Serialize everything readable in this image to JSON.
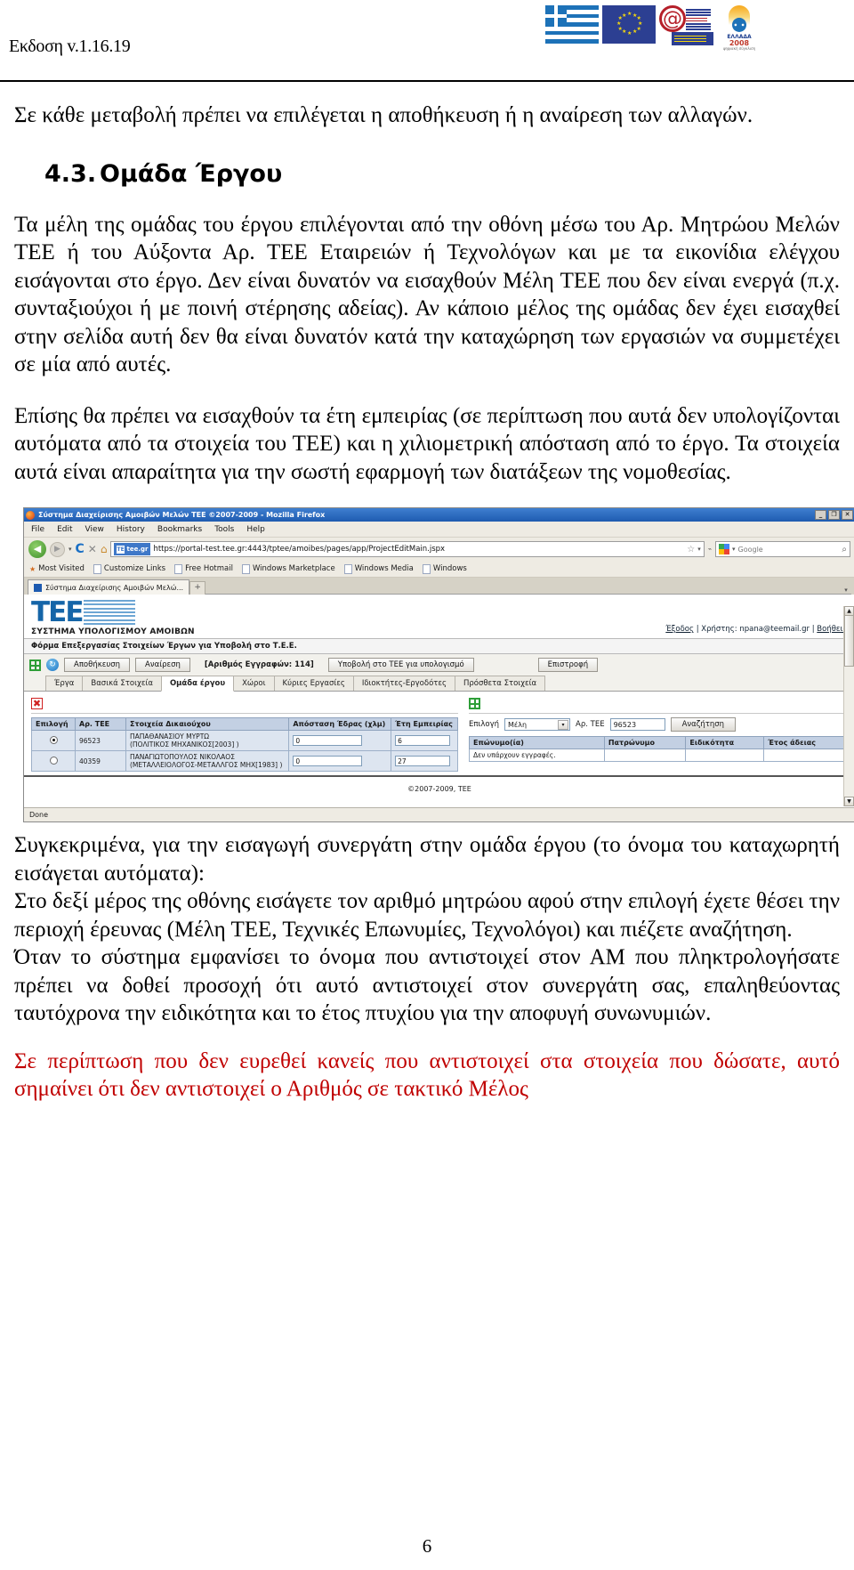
{
  "header": {
    "version_label": "Εκδοση v.1.16.19",
    "logos": [
      {
        "name": "greek-flag-logo",
        "alt": "Ελληνική Σημαία"
      },
      {
        "name": "eu-flag-logo",
        "alt": "Σημαία Ευρωπαϊκής Ένωσης"
      },
      {
        "name": "information-society-logo",
        "alt": "Κοινωνία της Πληροφορίας"
      },
      {
        "name": "greece-2008-logo",
        "alt": "ΕΛΛΑΔΑ 2008"
      }
    ],
    "greece2008": {
      "line1": "ΕΛΛΑΔΑ",
      "line2": "2008",
      "sub": "ψηφιακή σύγκλιση"
    }
  },
  "document": {
    "intro_paragraph": "Σε κάθε μεταβολή πρέπει να επιλέγεται η αποθήκευση ή η αναίρεση των αλλαγών.",
    "section": {
      "number": "4.3.",
      "title": "Ομάδα Έργου"
    },
    "paragraph_1": "Τα μέλη της ομάδας του έργου επιλέγονται από την οθόνη μέσω του Αρ. Μητρώου Μελών ΤΕΕ ή του Αύξοντα Αρ. ΤΕΕ Εταιρειών ή Τεχνολόγων και με τα εικονίδια ελέγχου εισάγονται στο έργο. Δεν είναι δυνατόν να εισαχθούν Μέλη ΤΕΕ που δεν είναι ενεργά (π.χ. συνταξιούχοι ή με ποινή στέρησης αδείας). Αν κάποιο μέλος της ομάδας δεν έχει εισαχθεί στην σελίδα αυτή δεν θα είναι δυνατόν κατά την καταχώρηση των εργασιών να συμμετέχει σε μία από αυτές.",
    "paragraph_2": "Επίσης θα πρέπει να εισαχθούν τα έτη εμπειρίας (σε περίπτωση που αυτά δεν υπολογίζονται αυτόματα από τα στοιχεία του ΤΕΕ) και η χιλιομετρική απόσταση από το έργο. Τα στοιχεία αυτά είναι απαραίτητα για την σωστή εφαρμογή των διατάξεων της νομοθεσίας.",
    "paragraph_3": "Συγκεκριμένα, για την εισαγωγή συνεργάτη στην ομάδα έργου (το όνομα του καταχωρητή εισάγεται αυτόματα):",
    "paragraph_4": "Στο δεξί μέρος της οθόνης εισάγετε τον αριθμό μητρώου αφού στην επιλογή έχετε θέσει την περιοχή έρευνας (Μέλη ΤΕΕ, Τεχνικές Επωνυμίες, Τεχνολόγοι) και πιέζετε αναζήτηση.",
    "paragraph_5": "Όταν το σύστημα εμφανίσει το όνομα που αντιστοιχεί στον ΑΜ που πληκτρολογήσατε  πρέπει να δοθεί προσοχή ότι αυτό αντιστοιχεί στον συνεργάτη σας, επαληθεύοντας ταυτόχρονα την ειδικότητα και το έτος πτυχίου για την αποφυγή συνωνυμιών.",
    "paragraph_red": "Σε περίπτωση που δεν ευρεθεί κανείς που αντιστοιχεί στα στοιχεία που δώσατε, αυτό σημαίνει ότι δεν αντιστοιχεί ο Αριθμός σε τακτικό Μέλος",
    "page_number": "6"
  },
  "screenshot": {
    "window": {
      "title": "Σύστημα Διαχείρισης Αμοιβών Μελών ΤΕΕ ©2007-2009 - Mozilla Firefox",
      "minimize": "_",
      "maximize": "❐",
      "close": "✕"
    },
    "menu": [
      "File",
      "Edit",
      "View",
      "History",
      "Bookmarks",
      "Tools",
      "Help"
    ],
    "nav": {
      "back_icon": "◀",
      "forward_icon": "▶",
      "reload_icon": "C",
      "stop_icon": "✕",
      "home_icon": "⌂",
      "identity_badge": "tee.gr",
      "url": "https://portal-test.tee.gr:4443/tptee/amoibes/pages/app/ProjectEditMain.jspx",
      "bookmark_star": "☆",
      "search_placeholder": "Google"
    },
    "bookmarks": [
      "Most Visited",
      "Customize Links",
      "Free Hotmail",
      "Windows Marketplace",
      "Windows Media",
      "Windows"
    ],
    "tab": {
      "label": "Σύστημα Διαχείρισης Αμοιβών Μελώ...",
      "new_tab": "+"
    },
    "app": {
      "brand": "ΤΕΕ",
      "brand_sub": "ΣΥΣΤΗΜΑ ΥΠΟΛΟΓΙΣΜΟΥ ΑΜΟΙΒΩΝ",
      "logout_link": "Έξοδος",
      "user_label": "Χρήστης:",
      "user_email": "npana@teemail.gr",
      "help_link": "Βοήθεια",
      "separator": "|",
      "form_title": "Φόρμα Επεξεργασίας Στοιχείων Έργων για Υποβολή στο Τ.Ε.Ε.",
      "toolbar": {
        "save": "Αποθήκευση",
        "undo": "Αναίρεση",
        "record_count": "[Αριθμός Εγγραφών: 114]",
        "submit": "Υποβολή στο ΤΕΕ για υπολογισμό",
        "back": "Επιστροφή"
      },
      "tabs": [
        {
          "label": "Έργα",
          "active": false
        },
        {
          "label": "Βασικά Στοιχεία",
          "active": false
        },
        {
          "label": "Ομάδα έργου",
          "active": true
        },
        {
          "label": "Χώροι",
          "active": false
        },
        {
          "label": "Κύριες Εργασίες",
          "active": false
        },
        {
          "label": "Ιδιοκτήτες-Εργοδότες",
          "active": false
        },
        {
          "label": "Πρόσθετα Στοιχεία",
          "active": false
        }
      ],
      "team_grid": {
        "headers": [
          "Επιλογή",
          "Αρ. ΤΕΕ",
          "Στοιχεία Δικαιούχου",
          "Απόσταση Έδρας (χλμ)",
          "Έτη Εμπειρίας"
        ],
        "rows": [
          {
            "selected": true,
            "tee_no": "96523",
            "name": "ΠΑΠΑΘΑΝΑΣΙΟΥ ΜΥΡΤΩ",
            "spec": "(ΠΟΛΙΤΙΚΟΣ ΜΗΧΑΝΙΚΟΣ[2003] )",
            "distance": "0",
            "years": "6"
          },
          {
            "selected": false,
            "tee_no": "40359",
            "name": "ΠΑΝΑΓΙΩΤΟΠΟΥΛΟΣ ΝΙΚΟΛΑΟΣ",
            "spec": "(ΜΕΤΑΛΛΕΙΟΛΟΓΟΣ-ΜΕΤΑΛΛΓΟΣ ΜΗΧ[1983] )",
            "distance": "0",
            "years": "27"
          }
        ]
      },
      "search_panel": {
        "label_selection": "Επιλογή",
        "selected_scope": "Μέλη",
        "label_tee_no": "Αρ. ΤΕΕ",
        "tee_no_value": "96523",
        "search_button": "Αναζήτηση",
        "headers": [
          "Επώνυμο(ία)",
          "Πατρώνυμο",
          "Ειδικότητα",
          "Έτος άδειας"
        ],
        "empty_message": "Δεν υπάρχουν εγγραφές."
      },
      "footer": "©2007-2009, ΤΕΕ"
    },
    "status": "Done"
  }
}
